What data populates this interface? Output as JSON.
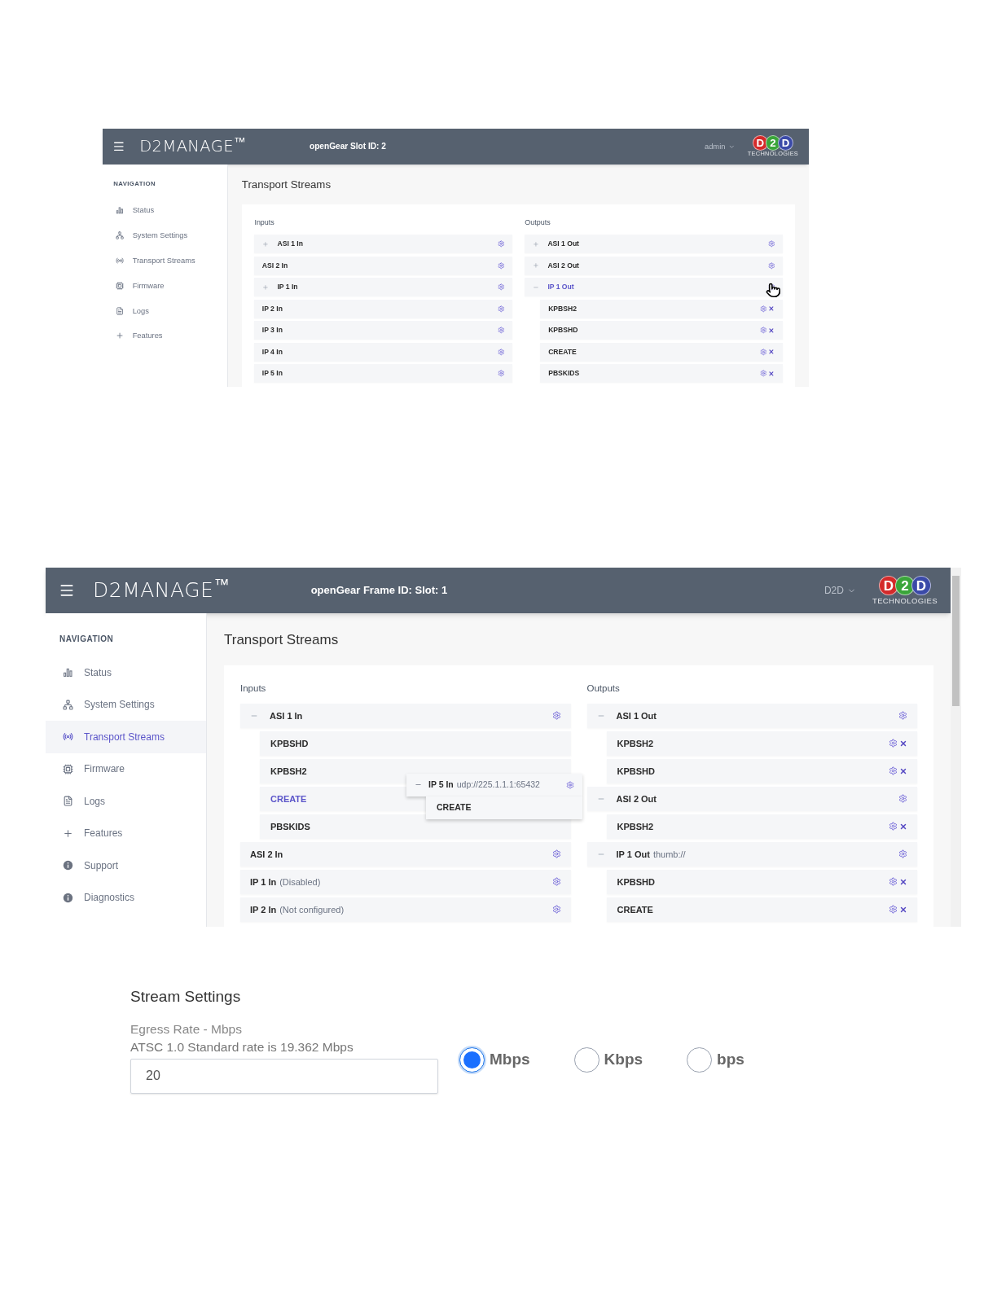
{
  "figures": [
    {
      "header": {
        "brand": "D2MANAGE$^{™}$",
        "title": "openGear Slot ID: 2",
        "user": "admin",
        "logo": {
          "letters": [
            {
              "text": "D",
              "color": "#d42a2a"
            },
            {
              "text": "2",
              "color": "#3aa53a"
            },
            {
              "text": "D",
              "color": "#3b4aa8"
            }
          ],
          "tagline": "TECHNOLOGIES"
        }
      },
      "navigation": {
        "heading": "NAVIGATION",
        "items": [
          {
            "label": "Status",
            "selected": false
          },
          {
            "label": "System Settings",
            "selected": false
          },
          {
            "label": "Transport Streams",
            "selected": false
          },
          {
            "label": "Firmware",
            "selected": false
          },
          {
            "label": "Logs",
            "selected": false
          },
          {
            "label": "Features",
            "selected": false
          }
        ]
      },
      "page_title": "Transport Streams",
      "scrollbar": false,
      "inputs": {
        "heading": "Inputs",
        "rows": [
          {
            "label": "ASI 1 In",
            "expanded": false,
            "highlighted": false,
            "hovered": false,
            "configurable": true,
            "removable": false
          },
          {
            "label": "ASI 2 In",
            "highlighted": false,
            "hovered": false,
            "configurable": true,
            "removable": false
          },
          {
            "label": "IP 1 In",
            "expanded": false,
            "highlighted": false,
            "hovered": false,
            "configurable": true,
            "removable": false
          },
          {
            "label": "IP 2 In",
            "highlighted": false,
            "hovered": false,
            "configurable": true,
            "removable": false
          },
          {
            "label": "IP 3 In",
            "highlighted": false,
            "hovered": false,
            "configurable": true,
            "removable": false
          },
          {
            "label": "IP 4 In",
            "highlighted": false,
            "hovered": false,
            "configurable": true,
            "removable": false
          },
          {
            "label": "IP 5 In",
            "highlighted": false,
            "hovered": false,
            "configurable": true,
            "removable": false
          }
        ]
      },
      "outputs": {
        "heading": "Outputs",
        "rows": [
          {
            "label": "ASI 1 Out",
            "expanded": false,
            "highlighted": false,
            "hovered": false,
            "configurable": true,
            "removable": false
          },
          {
            "label": "ASI 2 Out",
            "expanded": false,
            "highlighted": false,
            "hovered": false,
            "configurable": true,
            "removable": false
          },
          {
            "label": "IP 1 Out",
            "expanded": true,
            "highlighted": true,
            "hovered": true,
            "configurable": true,
            "removable": false,
            "children": [
              {
                "label": "KPBSH2",
                "highlighted": false,
                "configurable": true,
                "removable": true
              },
              {
                "label": "KPBSHD",
                "highlighted": false,
                "configurable": true,
                "removable": true
              },
              {
                "label": "CREATE",
                "highlighted": false,
                "configurable": true,
                "removable": true
              },
              {
                "label": "PBSKIDS",
                "highlighted": false,
                "configurable": true,
                "removable": true
              }
            ]
          }
        ]
      }
    },
    {
      "header": {
        "brand": "D2MANAGE$^{™}$",
        "title": "openGear Frame ID: Slot: 1",
        "user": "D2D",
        "logo": {
          "letters": [
            {
              "text": "D",
              "color": "#d42a2a"
            },
            {
              "text": "2",
              "color": "#3aa53a"
            },
            {
              "text": "D",
              "color": "#3b4aa8"
            }
          ],
          "tagline": "TECHNOLOGIES"
        }
      },
      "navigation": {
        "heading": "NAVIGATION",
        "items": [
          {
            "label": "Status",
            "selected": false
          },
          {
            "label": "System Settings",
            "selected": false
          },
          {
            "label": "Transport Streams",
            "selected": true
          },
          {
            "label": "Firmware",
            "selected": false
          },
          {
            "label": "Logs",
            "selected": false
          },
          {
            "label": "Features",
            "selected": false
          },
          {
            "label": "Support",
            "selected": false
          },
          {
            "label": "Diagnostics",
            "selected": false
          }
        ]
      },
      "page_title": "Transport Streams",
      "scrollbar": true,
      "inputs": {
        "heading": "Inputs",
        "rows": [
          {
            "label": "ASI 1 In",
            "expanded": true,
            "highlighted": false,
            "configurable": true,
            "removable": false,
            "children": [
              {
                "label": "KPBSHD",
                "highlighted": false,
                "configurable": false,
                "removable": false
              },
              {
                "label": "KPBSH2",
                "highlighted": false,
                "configurable": false,
                "removable": false
              },
              {
                "label": "CREATE",
                "highlighted": true,
                "configurable": false,
                "removable": false
              },
              {
                "label": "PBSKIDS",
                "highlighted": false,
                "configurable": false,
                "removable": false
              }
            ]
          },
          {
            "label": "ASI 2 In",
            "highlighted": false,
            "configurable": true,
            "removable": false
          },
          {
            "label": "IP 1 In",
            "note": "(Disabled)",
            "highlighted": false,
            "configurable": true,
            "removable": false
          },
          {
            "label": "IP 2 In",
            "note": "(Not configured)",
            "highlighted": false,
            "configurable": true,
            "removable": false
          }
        ]
      },
      "outputs": {
        "heading": "Outputs",
        "rows": [
          {
            "label": "ASI 1 Out",
            "expanded": true,
            "highlighted": false,
            "configurable": true,
            "removable": false,
            "children": [
              {
                "label": "KPBSH2",
                "highlighted": false,
                "configurable": true,
                "removable": true
              },
              {
                "label": "KPBSHD",
                "highlighted": false,
                "configurable": true,
                "removable": true
              }
            ]
          },
          {
            "label": "ASI 2 Out",
            "expanded": true,
            "highlighted": false,
            "configurable": true,
            "removable": false,
            "children": [
              {
                "label": "KPBSH2",
                "highlighted": false,
                "configurable": true,
                "removable": true
              }
            ]
          },
          {
            "label": "IP 1 Out",
            "note": "thumb://",
            "expanded": true,
            "highlighted": false,
            "configurable": true,
            "removable": false,
            "children": [
              {
                "label": "KPBSHD",
                "highlighted": false,
                "configurable": true,
                "removable": true
              },
              {
                "label": "CREATE",
                "highlighted": false,
                "configurable": true,
                "removable": true
              }
            ]
          }
        ]
      },
      "drag_preview": {
        "label": "IP 5 In",
        "note": "udp://225.1.1.1:65432",
        "expanded": true,
        "configurable": true,
        "child": "CREATE"
      }
    }
  ],
  "stream_settings": {
    "title": "Stream Settings",
    "label": "Egress Rate - Mbps",
    "hint": "ATSC 1.0 Standard rate is 19.362 Mbps",
    "value": "20",
    "units": [
      {
        "label": "Mbps",
        "selected": true
      },
      {
        "label": "Kbps",
        "selected": false
      },
      {
        "label": "bps",
        "selected": false
      }
    ]
  }
}
